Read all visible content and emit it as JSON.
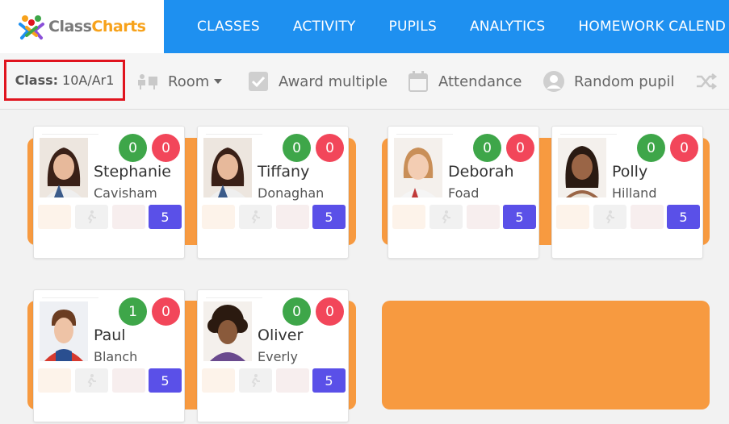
{
  "brand": {
    "logo_part1": "Class",
    "logo_part2": "Charts"
  },
  "nav": {
    "items": [
      "CLASSES",
      "ACTIVITY",
      "PUPILS",
      "ANALYTICS",
      "HOMEWORK CALEND"
    ]
  },
  "toolbar": {
    "class_label": "Class:",
    "class_value": "10A/Ar1",
    "room_label": "Room",
    "award_label": "Award multiple",
    "attendance_label": "Attendance",
    "random_label": "Random pupil"
  },
  "pupils": [
    {
      "first": "Stephanie",
      "last": "Cavisham",
      "positive": "0",
      "negative": "0",
      "count": "5"
    },
    {
      "first": "Tiffany",
      "last": "Donaghan",
      "positive": "0",
      "negative": "0",
      "count": "5"
    },
    {
      "first": "Deborah",
      "last": "Foad",
      "positive": "0",
      "negative": "0",
      "count": "5"
    },
    {
      "first": "Polly",
      "last": "Hilland",
      "positive": "0",
      "negative": "0",
      "count": "5"
    },
    {
      "first": "Paul",
      "last": "Blanch",
      "positive": "1",
      "negative": "0",
      "count": "5"
    },
    {
      "first": "Oliver",
      "last": "Everly",
      "positive": "0",
      "negative": "0",
      "count": "5"
    }
  ],
  "colors": {
    "nav_bg": "#1e90f0",
    "desk": "#f79a40",
    "positive": "#3ea649",
    "negative": "#f2465a",
    "count_chip": "#5a50e8",
    "class_highlight": "#e0141e"
  },
  "icons": [
    "classcharts-logo-icon",
    "room-icon",
    "chevron-down-icon",
    "checkbox-icon",
    "calendar-icon",
    "user-circle-icon",
    "shuffle-icon"
  ]
}
